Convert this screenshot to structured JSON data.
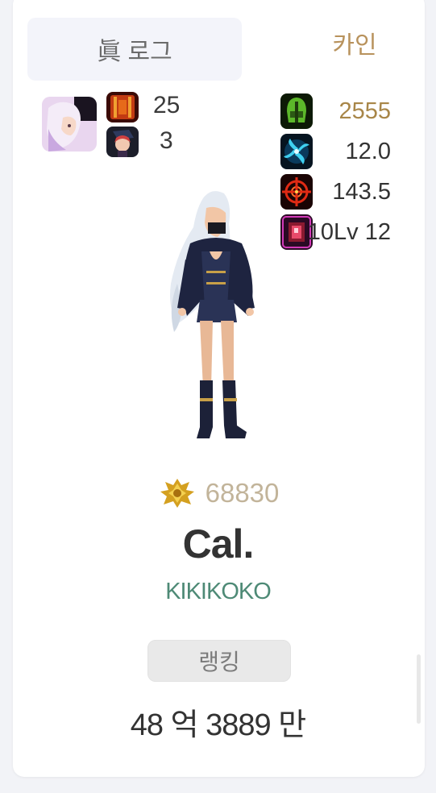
{
  "tabs": {
    "log_label": "眞 로그",
    "server_label": "카인"
  },
  "left_stats": {
    "item_count": "25",
    "other_count": "3"
  },
  "right_stats": [
    {
      "icon": "green-helmet-icon",
      "value": "2555",
      "color": "#a88648"
    },
    {
      "icon": "blue-swirl-icon",
      "value": "12.0",
      "color": "#333333"
    },
    {
      "icon": "red-crosshair-icon",
      "value": "143.5",
      "color": "#333333"
    },
    {
      "icon": "pink-gem-icon",
      "value": "10Lv 12",
      "color": "#333333"
    }
  ],
  "ranking": {
    "score": "68830",
    "button_label": "랭킹"
  },
  "character": {
    "name": "Cal.",
    "guild": "KIKIKOKO"
  },
  "combat_power": "48 억 3889 만"
}
